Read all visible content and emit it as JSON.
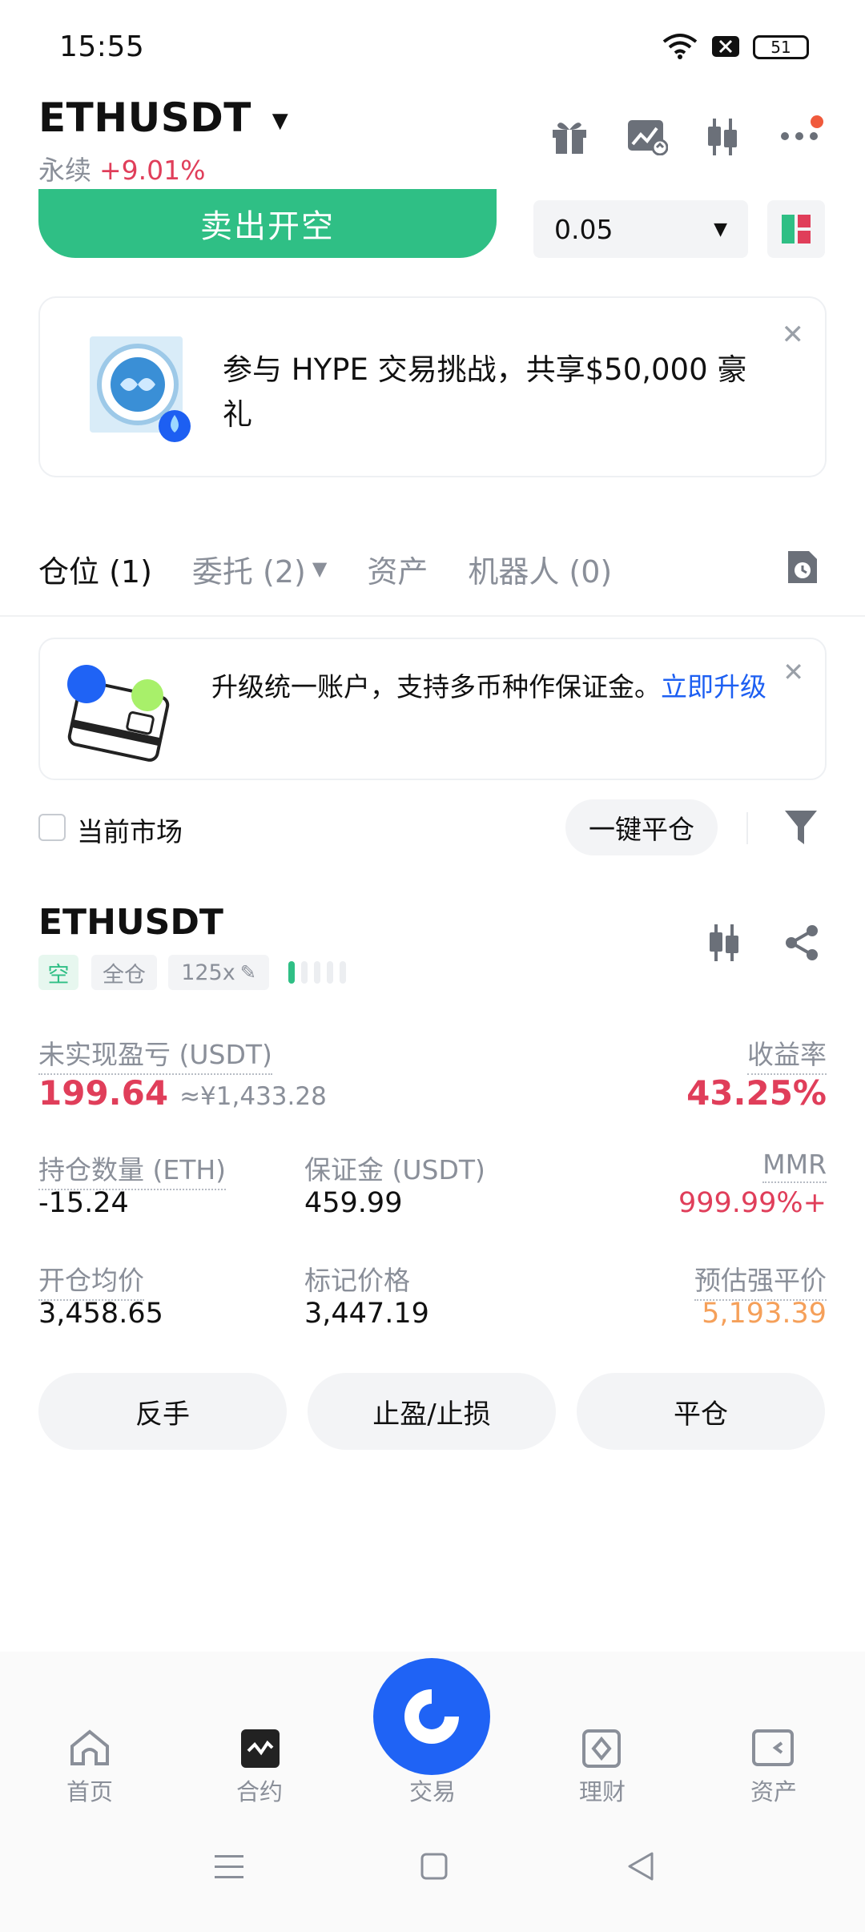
{
  "status_bar": {
    "time": "15:55",
    "battery": "51"
  },
  "header": {
    "symbol": "ETHUSDT",
    "contract_type": "永续",
    "change": "+9.01%",
    "icons": [
      "gift-icon",
      "chart-image-icon",
      "candlestick-icon",
      "more-icon"
    ]
  },
  "order": {
    "sell_label": "卖出开空",
    "quantity": "0.05"
  },
  "promo": {
    "text": "参与 HYPE 交易挑战，共享$50,000 豪礼",
    "close": "✕"
  },
  "tabs": [
    {
      "label": "仓位 (1)"
    },
    {
      "label": "委托 (2)"
    },
    {
      "label": "资产"
    },
    {
      "label": "机器人 (0)"
    }
  ],
  "upgrade_banner": {
    "text": "升级统一账户，支持多币种作保证金。",
    "link": "立即升级",
    "close": "✕"
  },
  "filter": {
    "current_market_label": "当前市场",
    "close_all_label": "一键平仓"
  },
  "position": {
    "symbol": "ETHUSDT",
    "tags": {
      "side": "空",
      "margin_mode": "全仓",
      "leverage": "125x"
    },
    "unrealized_pnl_label": "未实现盈亏 (USDT)",
    "unrealized_pnl": "199.64",
    "unrealized_pnl_cny": "≈¥1,433.28",
    "roe_label": "收益率",
    "roe": "43.25%",
    "size_label": "持仓数量 (ETH)",
    "size": "-15.24",
    "margin_label": "保证金 (USDT)",
    "margin": "459.99",
    "mmr_label": "MMR",
    "mmr": "999.99%+",
    "entry_label": "开仓均价",
    "entry": "3,458.65",
    "mark_label": "标记价格",
    "mark": "3,447.19",
    "liq_label": "预估强平价",
    "liq": "5,193.39"
  },
  "actions": {
    "reverse": "反手",
    "tpsl": "止盈/止损",
    "close": "平仓"
  },
  "bottom_nav": [
    {
      "label": "首页",
      "icon": "home-icon"
    },
    {
      "label": "合约",
      "icon": "futures-icon"
    },
    {
      "label": "交易",
      "icon": "trade-icon"
    },
    {
      "label": "理财",
      "icon": "earn-icon"
    },
    {
      "label": "资产",
      "icon": "wallet-icon"
    }
  ],
  "colors": {
    "green": "#2fbf85",
    "red": "#e03e5a",
    "orange": "#f5a05a",
    "blue": "#1f63f5"
  }
}
